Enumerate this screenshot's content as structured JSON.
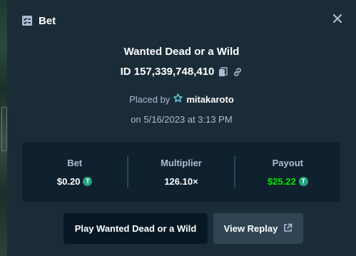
{
  "modal": {
    "title": "Bet",
    "close_icon": "close-icon",
    "header_icon": "bet-slip-icon"
  },
  "bet": {
    "game_name": "Wanted Dead or a Wild",
    "id_label": "ID 157,339,748,410",
    "placed_by_label": "Placed by",
    "username": "mitakaroto",
    "date_text": "on 5/16/2023 at 3:13 PM"
  },
  "stats": {
    "bet_label": "Bet",
    "bet_value": "$0.20",
    "multiplier_label": "Multiplier",
    "multiplier_value": "126.10×",
    "payout_label": "Payout",
    "payout_value": "$25.22",
    "currency_symbol": "T"
  },
  "actions": {
    "play_label": "Play Wanted Dead or a Wild",
    "replay_label": "View Replay"
  },
  "colors": {
    "background": "#1a2c38",
    "panel": "#0f212e",
    "payout_green": "#00e701",
    "muted_text": "#b1bad3",
    "tether_green": "#26a17b"
  }
}
